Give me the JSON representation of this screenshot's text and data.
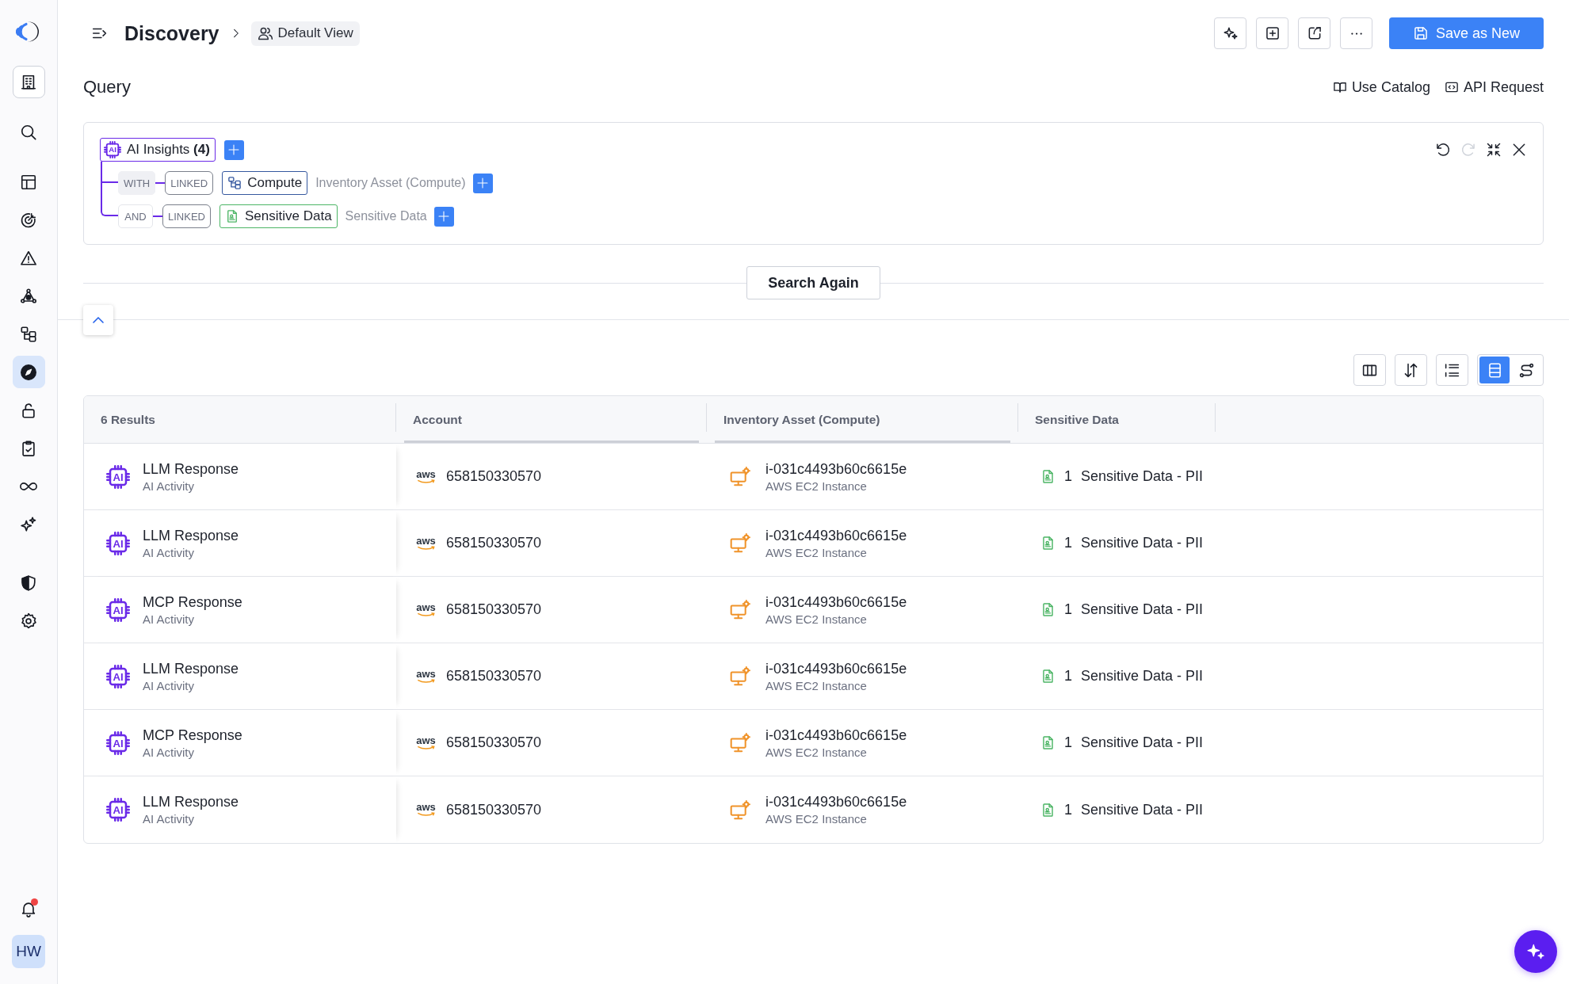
{
  "sidebar": {
    "groups": [
      {
        "items": [
          {
            "kind": "switcher",
            "selected": false
          }
        ]
      },
      {
        "items": [
          {
            "kind": "link",
            "selected": false
          }
        ]
      },
      {
        "items": [
          {
            "kind": "link",
            "selected": false
          },
          {
            "kind": "link",
            "selected": false
          },
          {
            "kind": "link",
            "selected": false
          },
          {
            "kind": "link",
            "selected": false
          },
          {
            "kind": "link",
            "selected": false
          },
          {
            "kind": "link",
            "selected": true
          },
          {
            "kind": "link",
            "selected": false
          },
          {
            "kind": "link",
            "selected": false
          },
          {
            "kind": "link",
            "selected": false
          },
          {
            "kind": "link",
            "selected": false
          }
        ]
      },
      {
        "items": [
          {
            "kind": "link",
            "selected": false
          },
          {
            "kind": "link",
            "selected": false
          }
        ]
      }
    ],
    "notifications": {
      "unread": true
    },
    "avatar": {
      "initials": "HW"
    }
  },
  "header": {
    "title": "Discovery",
    "view": "Default View",
    "primary_action": "Save as New"
  },
  "query": {
    "title": "Query",
    "links": [
      "Use Catalog",
      "API Request"
    ],
    "tools": [
      {
        "disabled": false
      },
      {
        "disabled": true
      },
      {
        "disabled": false
      },
      {
        "disabled": false
      }
    ],
    "root": {
      "icon_text": "AI",
      "label": "AI Insights **(4)**"
    },
    "clauses": [
      {
        "operator": "WITH",
        "highlighted": true,
        "relation": "LINKED",
        "kind": "compute",
        "entity": "Compute",
        "description": "Inventory Asset (Compute)"
      },
      {
        "operator": "AND",
        "highlighted": false,
        "relation": "LINKED",
        "kind": "data",
        "entity": "Sensitive Data",
        "description": "Sensitive Data"
      }
    ],
    "search_button": "Search Again"
  },
  "results": {
    "view_modes": [
      {
        "selected": true
      },
      {
        "selected": false
      }
    ],
    "columns": [
      {
        "label": "6 Results",
        "underlined": false
      },
      {
        "label": "Account",
        "underlined": true
      },
      {
        "label": "Inventory Asset (Compute)",
        "underlined": true
      },
      {
        "label": "Sensitive Data",
        "underlined": false
      }
    ],
    "rows": [
      {
        "icon_text": "AI",
        "name": "LLM Response",
        "type": "AI Activity",
        "provider": "aws",
        "account": "658150330570",
        "asset_id": "i-031c4493b60c6615e",
        "asset_type": "AWS EC2 Instance",
        "data_count": "1",
        "data_label": "Sensitive Data - PII"
      },
      {
        "icon_text": "AI",
        "name": "LLM Response",
        "type": "AI Activity",
        "provider": "aws",
        "account": "658150330570",
        "asset_id": "i-031c4493b60c6615e",
        "asset_type": "AWS EC2 Instance",
        "data_count": "1",
        "data_label": "Sensitive Data - PII"
      },
      {
        "icon_text": "AI",
        "name": "MCP Response",
        "type": "AI Activity",
        "provider": "aws",
        "account": "658150330570",
        "asset_id": "i-031c4493b60c6615e",
        "asset_type": "AWS EC2 Instance",
        "data_count": "1",
        "data_label": "Sensitive Data - PII"
      },
      {
        "icon_text": "AI",
        "name": "LLM Response",
        "type": "AI Activity",
        "provider": "aws",
        "account": "658150330570",
        "asset_id": "i-031c4493b60c6615e",
        "asset_type": "AWS EC2 Instance",
        "data_count": "1",
        "data_label": "Sensitive Data - PII"
      },
      {
        "icon_text": "AI",
        "name": "MCP Response",
        "type": "AI Activity",
        "provider": "aws",
        "account": "658150330570",
        "asset_id": "i-031c4493b60c6615e",
        "asset_type": "AWS EC2 Instance",
        "data_count": "1",
        "data_label": "Sensitive Data - PII"
      },
      {
        "icon_text": "AI",
        "name": "LLM Response",
        "type": "AI Activity",
        "provider": "aws",
        "account": "658150330570",
        "asset_id": "i-031c4493b60c6615e",
        "asset_type": "AWS EC2 Instance",
        "data_count": "1",
        "data_label": "Sensitive Data - PII"
      }
    ]
  }
}
